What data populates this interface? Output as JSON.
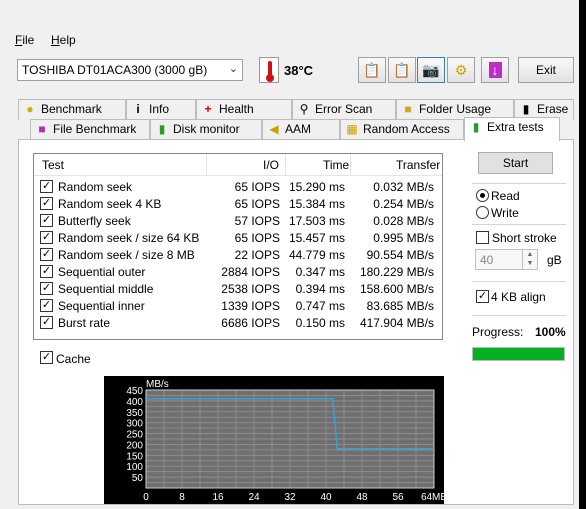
{
  "menu": {
    "file": "File",
    "file_key": "F",
    "file_rest": "ile",
    "help_key": "H",
    "help_rest": "elp"
  },
  "toolbar": {
    "drive": "TOSHIBA DT01ACA300 (3000 gB)",
    "temperature": "38°C",
    "exit_label": "Exit"
  },
  "tabs_top": [
    "Benchmark",
    "Info",
    "Health",
    "Error Scan",
    "Folder Usage",
    "Erase"
  ],
  "tabs_bottom": [
    "File Benchmark",
    "Disk monitor",
    "AAM",
    "Random Access",
    "Extra tests"
  ],
  "active_tab": "Extra tests",
  "table": {
    "headers": {
      "test": "Test",
      "io": "I/O",
      "time": "Time",
      "transfer": "Transfer"
    },
    "rows": [
      {
        "test": "Random seek",
        "io": "65 IOPS",
        "time": "15.290 ms",
        "transfer": "0.032 MB/s"
      },
      {
        "test": "Random seek 4 KB",
        "io": "65 IOPS",
        "time": "15.384 ms",
        "transfer": "0.254 MB/s"
      },
      {
        "test": "Butterfly seek",
        "io": "57 IOPS",
        "time": "17.503 ms",
        "transfer": "0.028 MB/s"
      },
      {
        "test": "Random seek / size 64 KB",
        "io": "65 IOPS",
        "time": "15.457 ms",
        "transfer": "0.995 MB/s"
      },
      {
        "test": "Random seek / size 8 MB",
        "io": "22 IOPS",
        "time": "44.779 ms",
        "transfer": "90.554 MB/s"
      },
      {
        "test": "Sequential outer",
        "io": "2884 IOPS",
        "time": "0.347 ms",
        "transfer": "180.229 MB/s"
      },
      {
        "test": "Sequential middle",
        "io": "2538 IOPS",
        "time": "0.394 ms",
        "transfer": "158.600 MB/s"
      },
      {
        "test": "Sequential inner",
        "io": "1339 IOPS",
        "time": "0.747 ms",
        "transfer": "83.685 MB/s"
      },
      {
        "test": "Burst rate",
        "io": "6686 IOPS",
        "time": "0.150 ms",
        "transfer": "417.904 MB/s"
      }
    ]
  },
  "cache_label": "Cache",
  "side": {
    "start_label": "Start",
    "read_label": "Read",
    "write_label": "Write",
    "short_stroke_label": "Short stroke",
    "stroke_value": "40",
    "stroke_unit": "gB",
    "align_label": "4 KB align",
    "progress_label": "Progress:",
    "progress_text": "100%",
    "progress_value": 1.0
  },
  "colors": {
    "progress": "#06b025",
    "series": "#3c9fd8",
    "chart_bg": "#6f6f6f",
    "grid": "#8c8c8c"
  },
  "chart_data": {
    "type": "line",
    "ylabel": "MB/s",
    "xunit": "MB",
    "y_ticks": [
      450,
      400,
      350,
      300,
      250,
      200,
      150,
      100,
      50
    ],
    "x_ticks": [
      0,
      8,
      16,
      24,
      32,
      40,
      48,
      56,
      64
    ],
    "xlim": [
      0,
      64
    ],
    "ylim": [
      0,
      450
    ],
    "series": [
      {
        "x": [
          0,
          41.5,
          42.5,
          64
        ],
        "y": [
          410,
          410,
          180,
          180
        ]
      }
    ],
    "grid": true
  }
}
